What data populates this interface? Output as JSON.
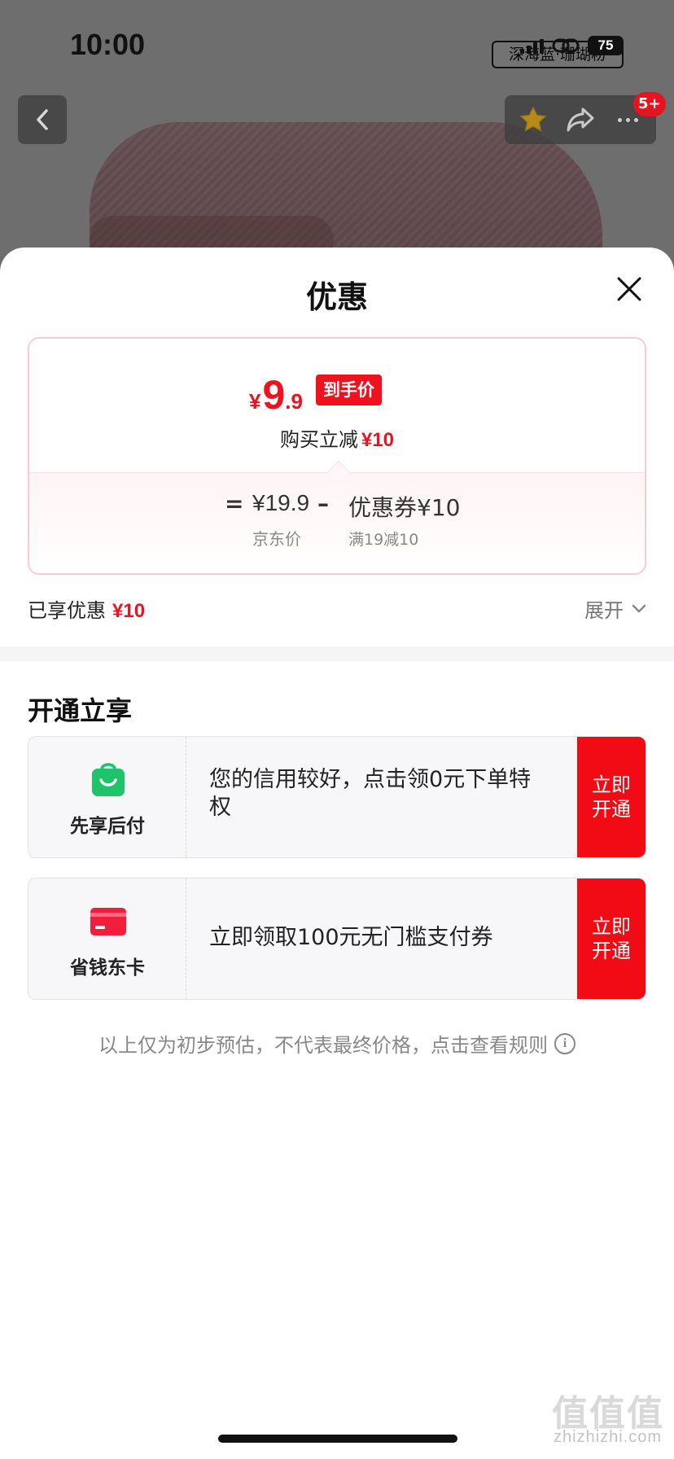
{
  "status_bar": {
    "time": "10:00",
    "battery": "75"
  },
  "product": {
    "variant": "深海蓝·珊瑚粉",
    "badge_count": "5+"
  },
  "sheet": {
    "title": "优惠",
    "price_card": {
      "currency": "¥",
      "final_integer": "9",
      "final_decimal": ".9",
      "final_label": "到手价",
      "reduce_text": "购买立减",
      "reduce_amount": "¥10",
      "formula_eq": "=",
      "jd_price": "¥19.9",
      "formula_minus": "–",
      "coupon_text": "优惠券¥10",
      "jd_price_label": "京东价",
      "coupon_rule": "满19减10"
    },
    "enjoyed": {
      "label": "已享优惠",
      "amount": "¥10",
      "expand": "展开"
    },
    "section_title": "开通立享",
    "offers": [
      {
        "name": "先享后付",
        "desc": "您的信用较好，点击领0元下单特权",
        "button": "立即开通",
        "icon": "shopping-bag-icon",
        "icon_color": "#1ec46a"
      },
      {
        "name": "省钱东卡",
        "desc": "立即领取100元无门槛支付券",
        "button": "立即开通",
        "icon": "card-icon",
        "icon_color": "#f01e3c"
      }
    ],
    "disclaimer": "以上仅为初步预估，不代表最终价格，点击查看规则"
  },
  "watermark": {
    "mark": "值值值",
    "site": "zhizhizhi.com"
  },
  "colors": {
    "accent_red": "#f0111f",
    "button_red": "#f20a14",
    "green": "#1ec46a"
  }
}
